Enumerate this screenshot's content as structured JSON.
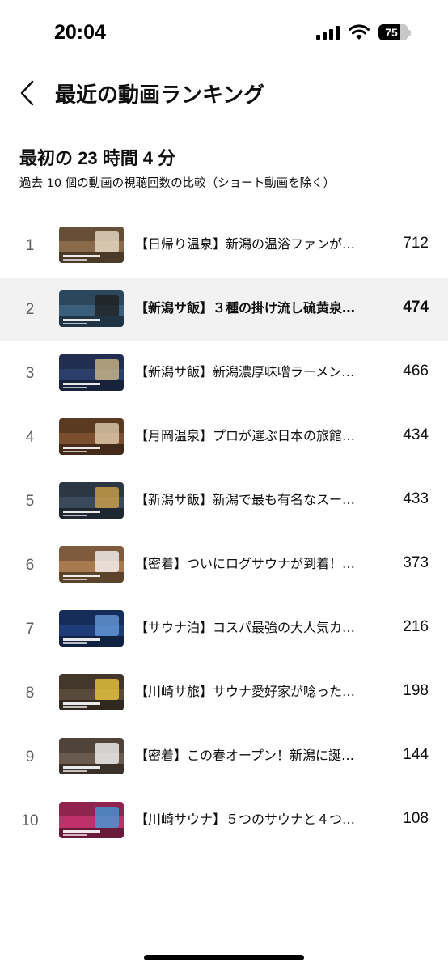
{
  "status_bar": {
    "time": "20:04",
    "battery": "75"
  },
  "header": {
    "title": "最近の動画ランキング"
  },
  "summary": {
    "title": "最初の 23 時間 4 分",
    "subtitle": "過去 10 個の動画の視聴回数の比較（ショート動画を除く）"
  },
  "rankings": [
    {
      "rank": "1",
      "title": "【日帰り温泉】新潟の温浴ファンが…",
      "views": "712",
      "highlighted": false
    },
    {
      "rank": "2",
      "title": "【新潟サ飯】３種の掛け流し硫黄泉…",
      "views": "474",
      "highlighted": true
    },
    {
      "rank": "3",
      "title": "【新潟サ飯】新潟濃厚味噌ラーメン…",
      "views": "466",
      "highlighted": false
    },
    {
      "rank": "4",
      "title": "【月岡温泉】プロが選ぶ日本の旅館…",
      "views": "434",
      "highlighted": false
    },
    {
      "rank": "5",
      "title": "【新潟サ飯】新潟で最も有名なスー…",
      "views": "433",
      "highlighted": false
    },
    {
      "rank": "6",
      "title": "【密着】ついにログサウナが到着！…",
      "views": "373",
      "highlighted": false
    },
    {
      "rank": "7",
      "title": "【サウナ泊】コスパ最強の大人気カ…",
      "views": "216",
      "highlighted": false
    },
    {
      "rank": "8",
      "title": "【川崎サ旅】サウナ愛好家が唸った…",
      "views": "198",
      "highlighted": false
    },
    {
      "rank": "9",
      "title": "【密着】この春オープン！新潟に誕…",
      "views": "144",
      "highlighted": false
    },
    {
      "rank": "10",
      "title": "【川崎サウナ】５つのサウナと４つ…",
      "views": "108",
      "highlighted": false
    }
  ],
  "thumbnails": [
    {
      "bg": "#8a6a4a",
      "accent": "#f0e6d2",
      "caption": ""
    },
    {
      "bg": "#3b5f7a",
      "accent": "#1c1c1c",
      "caption": ""
    },
    {
      "bg": "#2c3e6b",
      "accent": "#d9c18a",
      "caption": ""
    },
    {
      "bg": "#7a4e2e",
      "accent": "#e8d7b8",
      "caption": ""
    },
    {
      "bg": "#3a4a5a",
      "accent": "#d8a848",
      "caption": ""
    },
    {
      "bg": "#a87a50",
      "accent": "#ffffff",
      "caption": ""
    },
    {
      "bg": "#1e3c78",
      "accent": "#6aa0e0",
      "caption": ""
    },
    {
      "bg": "#5a4a3a",
      "accent": "#f4d040",
      "caption": ""
    },
    {
      "bg": "#6a5a4e",
      "accent": "#ffffff",
      "caption": ""
    },
    {
      "bg": "#c0306a",
      "accent": "#3aa0e0",
      "caption": ""
    }
  ]
}
